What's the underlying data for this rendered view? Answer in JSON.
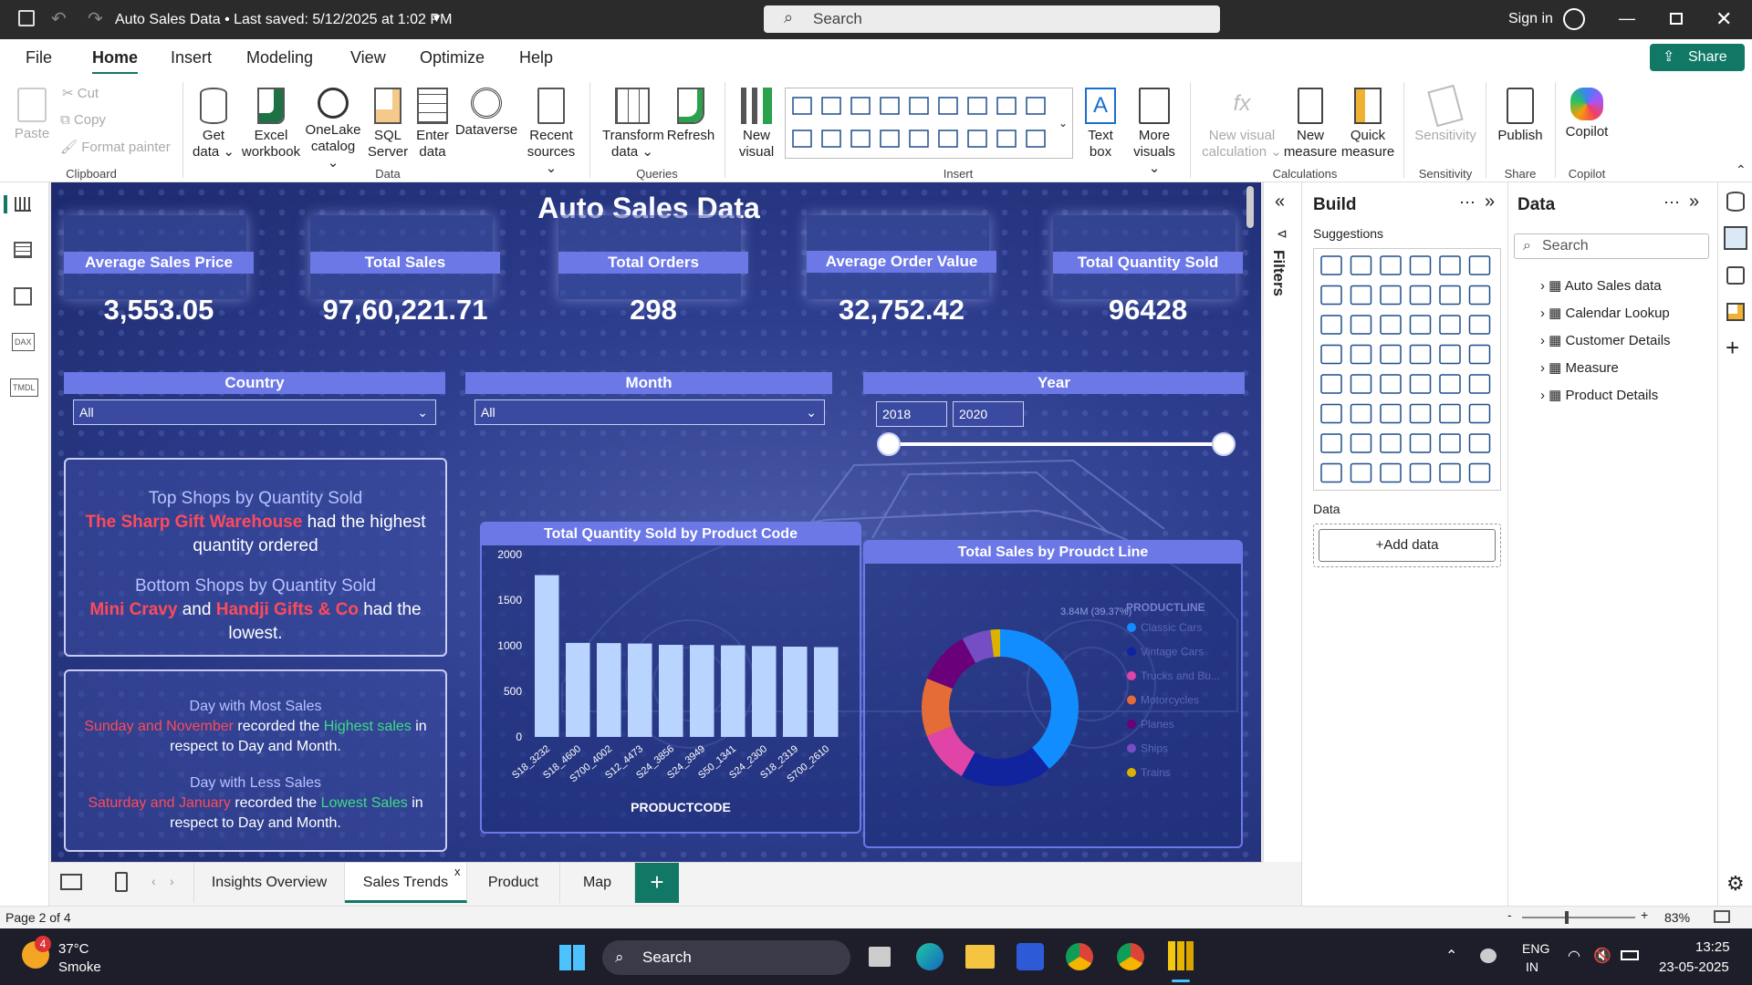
{
  "titlebar": {
    "title": "Auto Sales Data • Last saved: 5/12/2025 at 1:02 PM",
    "search": "Search",
    "signin": "Sign in"
  },
  "menu": {
    "tabs": [
      "File",
      "Home",
      "Insert",
      "Modeling",
      "View",
      "Optimize",
      "Help"
    ],
    "share": "Share"
  },
  "ribbon": {
    "clipboard": {
      "paste": "Paste",
      "cut": "Cut",
      "copy": "Copy",
      "format": "Format painter",
      "group": "Clipboard"
    },
    "data": {
      "get": "Get data",
      "excel": "Excel workbook",
      "onelake": "OneLake catalog",
      "sql": "SQL Server",
      "enter": "Enter data",
      "dataverse": "Dataverse",
      "recent": "Recent sources",
      "group": "Data"
    },
    "queries": {
      "transform": "Transform data",
      "refresh": "Refresh",
      "group": "Queries"
    },
    "insert": {
      "newvisual": "New visual",
      "textbox": "Text box",
      "more": "More visuals",
      "group": "Insert"
    },
    "calc": {
      "newcalc": "New visual calculation",
      "newmeasure": "New measure",
      "quick": "Quick measure",
      "group": "Calculations"
    },
    "sensitivity": {
      "label": "Sensitivity",
      "group": "Sensitivity"
    },
    "share": {
      "publish": "Publish",
      "group": "Share"
    },
    "copilot": {
      "label": "Copilot",
      "group": "Copilot"
    }
  },
  "report": {
    "title": "Auto Sales Data",
    "kpis": [
      {
        "label": "Average Sales Price",
        "value": "3,553.05"
      },
      {
        "label": "Total Sales",
        "value": "97,60,221.71"
      },
      {
        "label": "Total Orders",
        "value": "298"
      },
      {
        "label": "Average Order Value",
        "value": "32,752.42"
      },
      {
        "label": "Total Quantity Sold",
        "value": "96428"
      }
    ],
    "slicers": {
      "country": {
        "label": "Country",
        "value": "All"
      },
      "month": {
        "label": "Month",
        "value": "All"
      },
      "year": {
        "label": "Year",
        "from": "2018",
        "to": "2020"
      }
    },
    "insight1": {
      "top_title": "Top Shops by Quantity Sold",
      "top_shop": "The Sharp Gift Warehouse",
      "top_text1": "had the highest",
      "top_text2": "quantity ordered",
      "bottom_title": "Bottom Shops by Quantity Sold",
      "shop_a": "Mini Cravy",
      "and": "and",
      "shop_b": "Handji Gifts & Co",
      "had_the": "had the",
      "lowest": "lowest."
    },
    "insight2": {
      "most_title": "Day with Most Sales",
      "most_red": "Sunday and November",
      "recorded": "recorded the",
      "highest": "Highest sales",
      "in": "in",
      "respect": "respect to Day and Month.",
      "less_title": "Day with Less Sales",
      "less_red": "Saturday and January",
      "lowest": "Lowest Sales"
    }
  },
  "chart_data": [
    {
      "type": "bar",
      "title": "Total Quantity Sold by Product Code",
      "xlabel": "PRODUCTCODE",
      "ylabel": "",
      "categories": [
        "S18_3232",
        "S18_4600",
        "S700_4002",
        "S12_4473",
        "S24_3856",
        "S24_3949",
        "S50_1341",
        "S24_2300",
        "S18_2319",
        "S700_2610"
      ],
      "values": [
        1774,
        1031,
        1029,
        1024,
        1010,
        1008,
        1004,
        996,
        990,
        985
      ],
      "ylim": [
        0,
        2000
      ],
      "yticks": [
        0,
        500,
        1000,
        1500,
        2000
      ]
    },
    {
      "type": "pie",
      "title": "Total Sales by Proudct Line",
      "legend_title": "PRODUCTLINE",
      "categories": [
        "Classic Cars",
        "Vintage Cars",
        "Trucks and Bu...",
        "Motorcycles",
        "Planes",
        "Ships",
        "Trains"
      ],
      "values": [
        39.37,
        19.0,
        11.0,
        12.0,
        11.0,
        6.0,
        2.0
      ],
      "colors": [
        "#118dff",
        "#12239e",
        "#e044a7",
        "#e66c37",
        "#6b007b",
        "#744ec2",
        "#d9b300"
      ],
      "labels": [
        "3.84M (39.37%)",
        "",
        "",
        "",
        "",
        "",
        ""
      ]
    }
  ],
  "pages": {
    "tabs": [
      "Insights Overview",
      "Sales Trends",
      "Product",
      "Map"
    ],
    "status": "Page 2 of 4",
    "zoom": "83%"
  },
  "build": {
    "title": "Build",
    "suggestions": "Suggestions",
    "data": "Data",
    "add": "+Add data"
  },
  "datapane": {
    "title": "Data",
    "search": "Search",
    "tables": [
      "Auto Sales data",
      "Calendar Lookup",
      "Customer Details",
      "Measure",
      "Product Details"
    ]
  },
  "filters": "Filters",
  "taskbar": {
    "temp": "37°C",
    "weather": "Smoke",
    "search": "Search",
    "lang1": "ENG",
    "lang2": "IN",
    "time": "13:25",
    "date": "23-05-2025",
    "badge": "4"
  }
}
